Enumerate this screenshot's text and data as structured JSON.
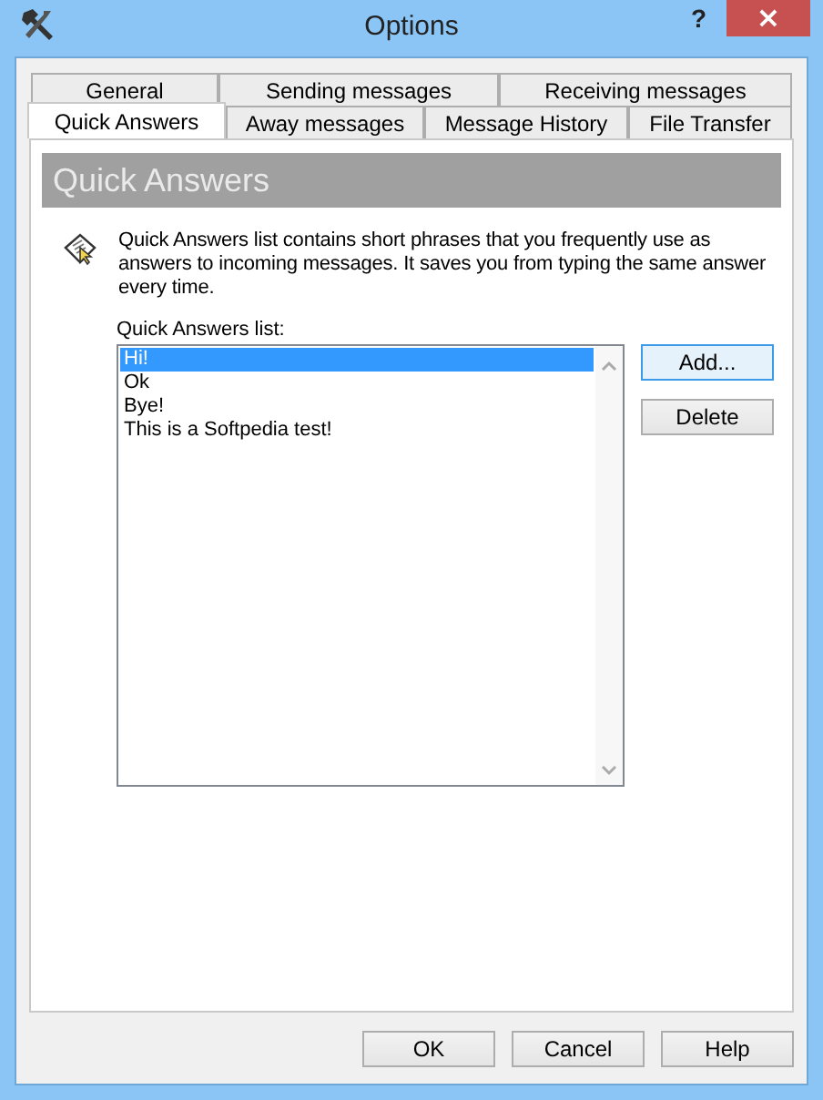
{
  "window": {
    "title": "Options",
    "help_glyph": "?",
    "close_glyph": "×"
  },
  "tab_rows": [
    [
      {
        "label": "General",
        "selected": false
      },
      {
        "label": "Sending messages",
        "selected": false
      },
      {
        "label": "Receiving messages",
        "selected": false
      }
    ],
    [
      {
        "label": "Quick Answers",
        "selected": true
      },
      {
        "label": "Away messages",
        "selected": false
      },
      {
        "label": "Message History",
        "selected": false
      },
      {
        "label": "File Transfer",
        "selected": false
      }
    ]
  ],
  "panel": {
    "heading": "Quick Answers",
    "description": "Quick Answers list contains short phrases that you frequently use as answers to incoming messages. It saves you from typing the same answer every time.",
    "list_label": "Quick Answers list:",
    "items": [
      {
        "text": "Hi!",
        "selected": true
      },
      {
        "text": "Ok",
        "selected": false
      },
      {
        "text": "Bye!",
        "selected": false
      },
      {
        "text": "This is a Softpedia test!",
        "selected": false
      }
    ],
    "side_buttons": [
      {
        "label": "Add...",
        "focused": true
      },
      {
        "label": "Delete",
        "focused": false
      }
    ]
  },
  "buttons": [
    "OK",
    "Cancel",
    "Help"
  ]
}
